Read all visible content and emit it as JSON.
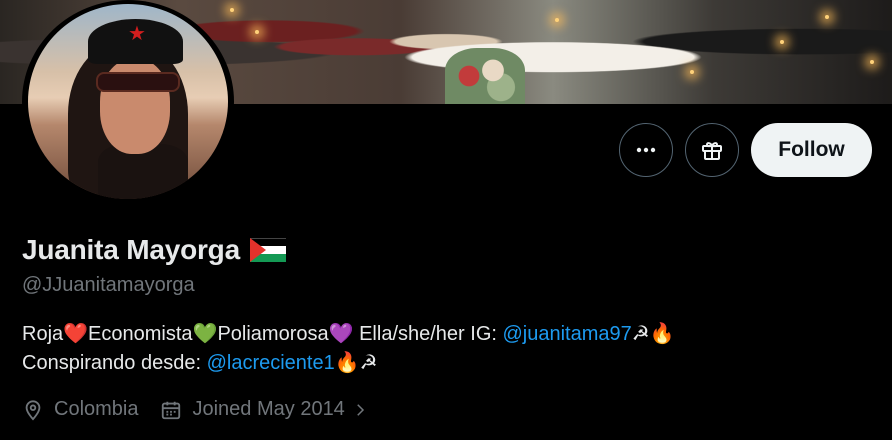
{
  "profile": {
    "name": "Juanita Mayorga",
    "handle": "@JJuanitamayorga",
    "bio": {
      "line1": {
        "t1": "Roja",
        "e1": "❤️",
        "t2": "Economista",
        "e2": "💚",
        "t3": "Poliamorosa",
        "e3": "💜",
        "t4": " Ella/she/her IG: ",
        "link": "@juanitama97",
        "e4": "☭",
        "e5": "🔥"
      },
      "line2": {
        "t1": "Conspirando desde: ",
        "link": "@lacreciente1",
        "e1": "🔥",
        "e2": "☭"
      }
    },
    "location": "Colombia",
    "joined": "Joined May 2014"
  },
  "actions": {
    "follow_label": "Follow"
  },
  "colors": {
    "background": "#000000",
    "link": "#1d9bf0",
    "muted": "#71767b",
    "button_bg": "#eff3f4"
  },
  "icons": [
    "more-icon",
    "gift-icon",
    "location-icon",
    "calendar-icon",
    "chevron-right-icon",
    "palestine-flag-icon"
  ]
}
